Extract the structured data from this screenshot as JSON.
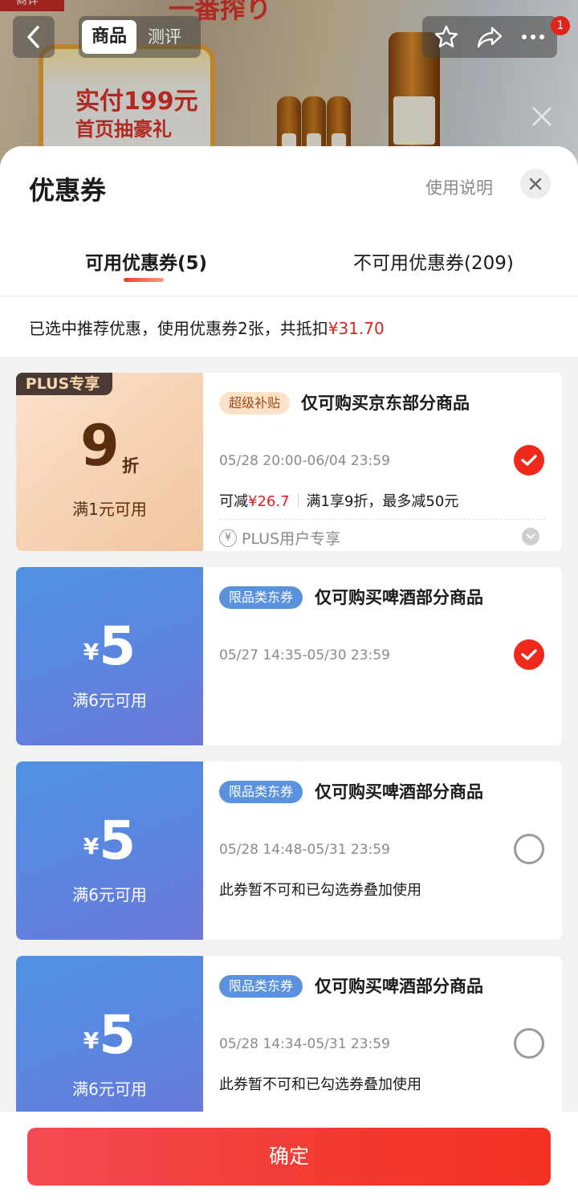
{
  "product_bg": {
    "top_chip": "商详",
    "banner_title": "一番搾り",
    "promo_line1": "实付199元",
    "promo_line2": "首页抽豪礼"
  },
  "nav": {
    "tab_goods": "商品",
    "tab_review": "测评",
    "badge_count": "1"
  },
  "sheet": {
    "title": "优惠券",
    "help": "使用说明",
    "tabs": [
      {
        "label": "可用优惠券(5)",
        "active": true
      },
      {
        "label": "不可用优惠券(209)",
        "active": false
      }
    ],
    "summary_prefix": "已选中推荐优惠，使用优惠券2张，共抵扣",
    "summary_amount": "¥31.70"
  },
  "coupons": [
    {
      "badge": "PLUS专享",
      "discount": "9",
      "discount_unit": "折",
      "condition": "满1元可用",
      "tag": "超级补贴",
      "title": "仅可购买京东部分商品",
      "date": "05/28 20:00-06/04 23:59",
      "note_prefix": "可减",
      "note_amount": "¥26.7",
      "note_rule": "满1享9折，最多减50元",
      "footer": "PLUS用户专享",
      "checked": true
    },
    {
      "currency": "¥",
      "amount": "5",
      "condition": "满6元可用",
      "tag": "限品类东券",
      "title": "仅可购买啤酒部分商品",
      "date": "05/27 14:35-05/30 23:59",
      "checked": true
    },
    {
      "currency": "¥",
      "amount": "5",
      "condition": "满6元可用",
      "tag": "限品类东券",
      "title": "仅可购买啤酒部分商品",
      "date": "05/28 14:48-05/31 23:59",
      "note": "此券暂不可和已勾选券叠加使用",
      "checked": false
    },
    {
      "currency": "¥",
      "amount": "5",
      "condition": "满6元可用",
      "tag": "限品类东券",
      "title": "仅可购买啤酒部分商品",
      "date": "05/28 14:34-05/31 23:59",
      "note": "此券暂不可和已勾选券叠加使用",
      "checked": false
    }
  ],
  "footer": {
    "confirm": "确定"
  },
  "colors": {
    "accent_red": "#e2231a",
    "plus_brown": "#5a2d0f",
    "coupon_blue": "#5b86e0"
  }
}
